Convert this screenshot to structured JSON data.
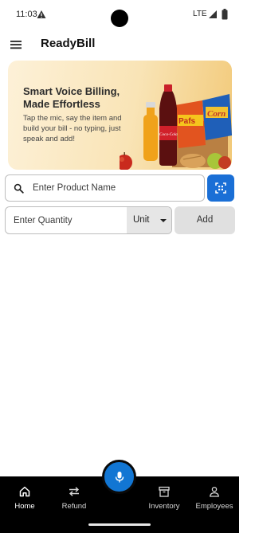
{
  "status_bar": {
    "time": "11:03",
    "network": "LTE",
    "alert_icon": "warning-icon",
    "signal_icon": "signal-icon",
    "battery_icon": "battery-icon"
  },
  "app_bar": {
    "title": "ReadyBill",
    "menu_icon": "menu-icon"
  },
  "banner": {
    "title": "Smart Voice Billing, Made Effortless",
    "subtitle": "Tap the mic, say the item and build your bill - no typing, just speak and add!",
    "art_labels": [
      "Coca-Cola",
      "Pafs",
      "Corn"
    ]
  },
  "search": {
    "placeholder": "Enter Product Name",
    "value": "",
    "scan_icon": "barcode-scan-icon"
  },
  "quantity": {
    "placeholder": "Enter Quantity",
    "value": "",
    "unit_label": "Unit",
    "add_label": "Add"
  },
  "bottom_nav": {
    "items": [
      {
        "label": "Home",
        "icon": "home-icon",
        "active": true
      },
      {
        "label": "Refund",
        "icon": "swap-arrows-icon",
        "active": false
      },
      {
        "label": "Inventory",
        "icon": "archive-box-icon",
        "active": false
      },
      {
        "label": "Employees",
        "icon": "person-icon",
        "active": false
      }
    ],
    "fab_icon": "microphone-icon"
  },
  "colors": {
    "accent": "#1a6fd6",
    "fab": "#1276d3",
    "nav_background": "#000000",
    "banner_start": "#fdf1d8",
    "banner_end": "#f2c978"
  }
}
